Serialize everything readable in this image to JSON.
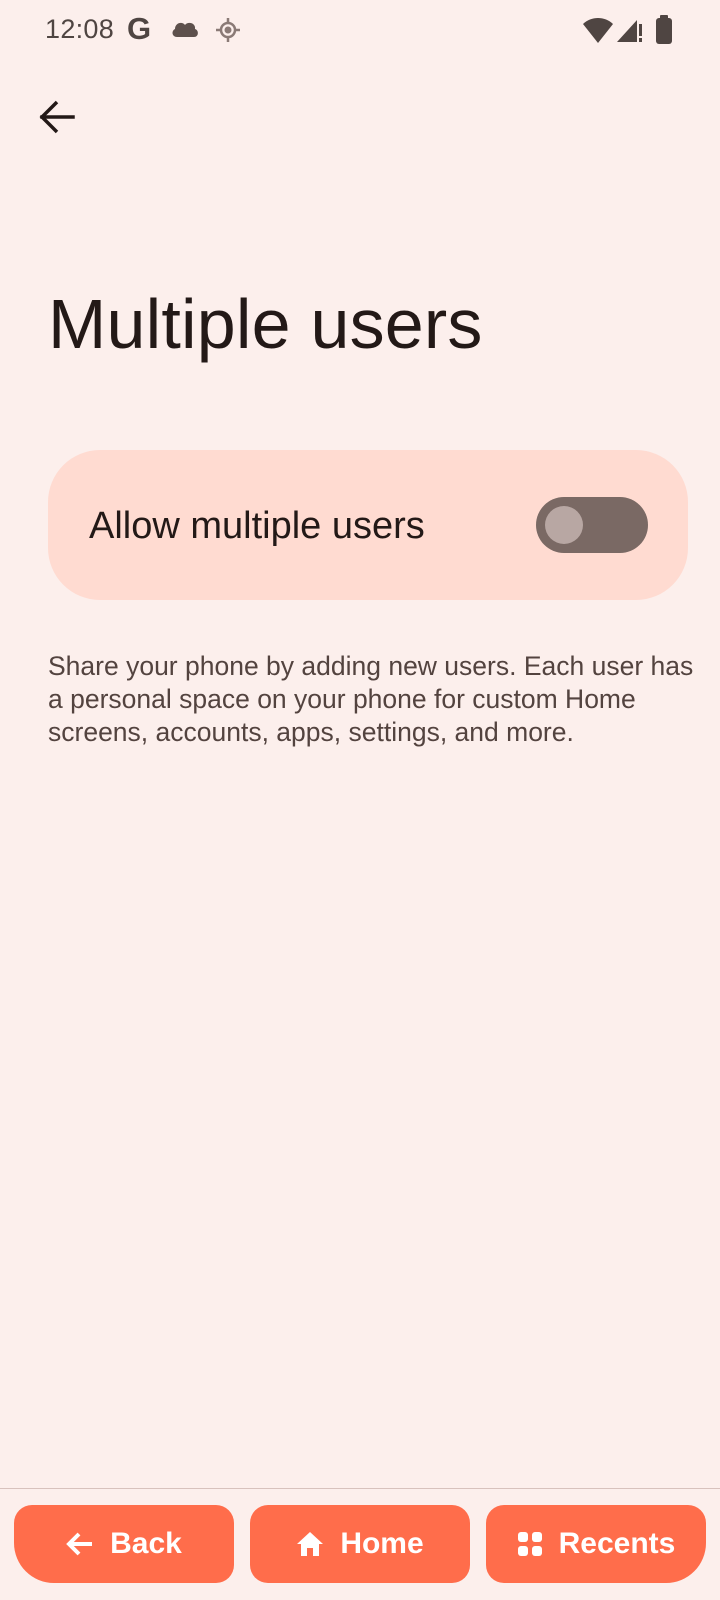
{
  "status_bar": {
    "time": "12:08",
    "g_label": "G",
    "icons": [
      "google-icon",
      "cloud-icon",
      "location-icon",
      "wifi-icon",
      "signal-icon",
      "battery-icon"
    ]
  },
  "header": {
    "back_icon": "arrow-left-icon"
  },
  "page": {
    "title": "Multiple users"
  },
  "toggle": {
    "label": "Allow multiple users",
    "checked": false,
    "track_color": "#7a6964",
    "card_color": "#ffdbd1"
  },
  "description": "Share your phone by adding new users. Each user has a personal space on your phone for custom Home screens, accounts, apps, settings, and more.",
  "nav": {
    "back_label": "Back",
    "home_label": "Home",
    "recents_label": "Recents",
    "accent_color": "#ff6d4b"
  },
  "colors": {
    "background": "#fcefec",
    "title_text": "#231917",
    "body_text": "#53433f"
  }
}
